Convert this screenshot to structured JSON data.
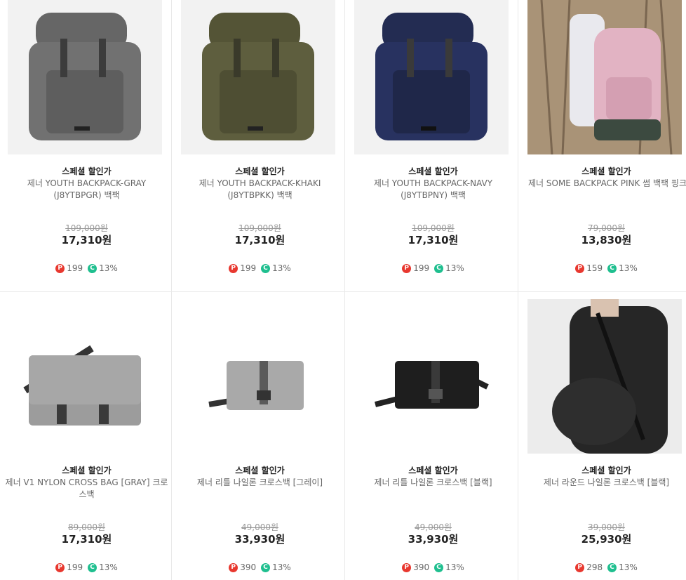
{
  "products": [
    {
      "badge": "스페셜 할인가",
      "name": "제너 YOUTH BACKPACK-GRAY (J8YTBPGR) 백팩",
      "original_price": "109,000원",
      "price": "17,310원",
      "points": "199",
      "discount": "13%",
      "color": "#6e6e6e",
      "image": "gray-backpack-icon"
    },
    {
      "badge": "스페셜 할인가",
      "name": "제너 YOUTH BACKPACK-KHAKI (J8YTBPKK) 백팩",
      "original_price": "109,000원",
      "price": "17,310원",
      "points": "199",
      "discount": "13%",
      "color": "#5a5a3c",
      "image": "khaki-backpack-icon"
    },
    {
      "badge": "스페셜 할인가",
      "name": "제너 YOUTH BACKPACK-NAVY (J8YTBPNY) 백팩",
      "original_price": "109,000원",
      "price": "17,310원",
      "points": "199",
      "discount": "13%",
      "color": "#25305a",
      "image": "navy-backpack-icon"
    },
    {
      "badge": "스페셜 할인가",
      "name": "제너 SOME BACKPACK PINK 썸 백팩 핑크",
      "original_price": "79,000원",
      "price": "13,830원",
      "points": "159",
      "discount": "13%",
      "color": "#e0b2c0",
      "image": "pink-backpack-icon"
    },
    {
      "badge": "스페셜 할인가",
      "name": "제너 V1 NYLON CROSS BAG [GRAY] 크로스백",
      "original_price": "89,000원",
      "price": "17,310원",
      "points": "199",
      "discount": "13%",
      "color": "#9a9a9a",
      "image": "gray-messenger-bag-icon"
    },
    {
      "badge": "스페셜 할인가",
      "name": "제너 리틀 나일론 크로스백 [그레이]",
      "original_price": "49,000원",
      "price": "33,930원",
      "points": "390",
      "discount": "13%",
      "color": "#a4a4a4",
      "image": "gray-crossbag-icon"
    },
    {
      "badge": "스페셜 할인가",
      "name": "제너 리틀 나일론 크로스백 [블랙]",
      "original_price": "49,000원",
      "price": "33,930원",
      "points": "390",
      "discount": "13%",
      "color": "#1e1e1e",
      "image": "black-crossbag-icon"
    },
    {
      "badge": "스페셜 할인가",
      "name": "제너 라운드 나일론 크로스백 [블랙]",
      "original_price": "39,000원",
      "price": "25,930원",
      "points": "298",
      "discount": "13%",
      "color": "#2a2a2a",
      "image": "round-crossbag-icon"
    }
  ],
  "icons": {
    "point": "P",
    "cash": "C"
  }
}
